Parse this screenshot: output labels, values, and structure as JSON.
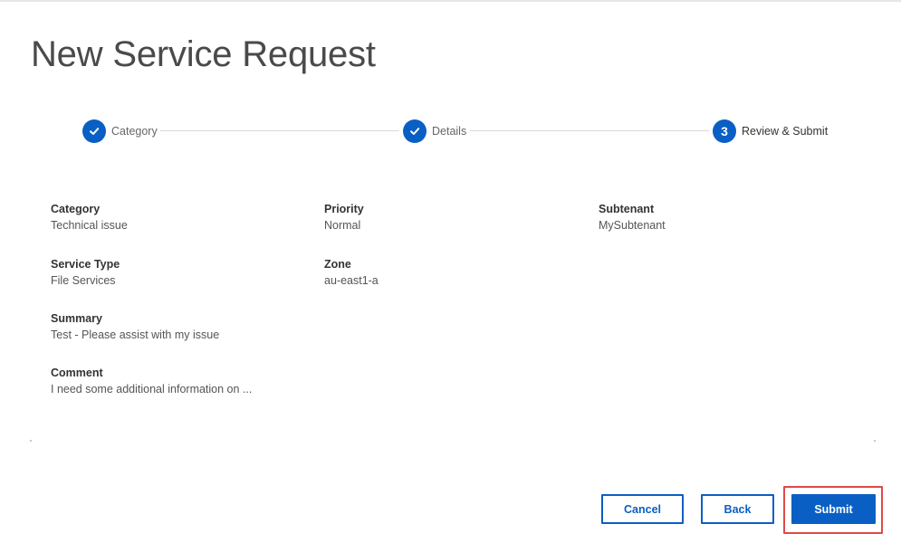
{
  "page": {
    "title": "New Service Request"
  },
  "stepper": {
    "steps": [
      {
        "label": "Category",
        "status": "complete",
        "marker": "check-icon"
      },
      {
        "label": "Details",
        "status": "complete",
        "marker": "check-icon"
      },
      {
        "label": "Review & Submit",
        "status": "active",
        "number": "3"
      }
    ]
  },
  "review": {
    "fields": [
      {
        "label": "Category",
        "value": "Technical issue"
      },
      {
        "label": "Priority",
        "value": "Normal"
      },
      {
        "label": "Subtenant",
        "value": "MySubtenant"
      },
      {
        "label": "Service Type",
        "value": "File Services"
      },
      {
        "label": "Zone",
        "value": "au-east1-a"
      },
      {
        "label": "Summary",
        "value": "Test - Please assist with my issue"
      },
      {
        "label": "Comment",
        "value": "I need some additional information on ..."
      }
    ]
  },
  "actions": {
    "cancel_label": "Cancel",
    "back_label": "Back",
    "submit_label": "Submit"
  },
  "colors": {
    "accent": "#0a5fc4",
    "highlight": "#e04848"
  }
}
